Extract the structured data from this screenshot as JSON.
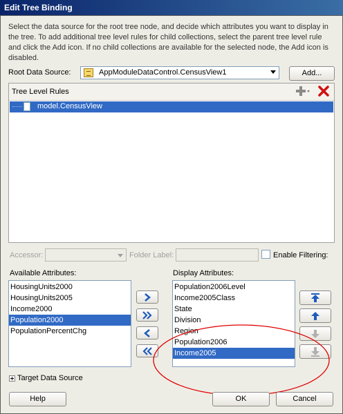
{
  "window": {
    "title": "Edit Tree Binding"
  },
  "description": "Select the data source for the root tree node, and decide which attributes you want to display in the tree. To add additional tree level rules for child collections, select the parent tree level rule and click the Add icon. If no child collections are available for the selected node, the Add icon is disabled.",
  "root_source": {
    "label": "Root Data Source:",
    "value": "AppModuleDataControl.CensusView1",
    "add_label": "Add..."
  },
  "tree_rules": {
    "header": "Tree Level Rules",
    "nodes": [
      "model.CensusView"
    ]
  },
  "accessor": {
    "label": "Accessor:",
    "value": ""
  },
  "folder_label": {
    "label": "Folder Label:",
    "value": ""
  },
  "enable_filtering": {
    "label": "Enable Filtering:",
    "checked": false
  },
  "available": {
    "label": "Available Attributes:",
    "items": [
      "HousingUnits2000",
      "HousingUnits2005",
      "Income2000",
      "Population2000",
      "PopulationPercentChg"
    ],
    "selected": 3
  },
  "display": {
    "label": "Display Attributes:",
    "items": [
      "Population2006Level",
      "Income2005Class",
      "State",
      "Division",
      "Region",
      "Population2006",
      "Income2005"
    ],
    "selected": 6
  },
  "target": {
    "label": "Target Data Source"
  },
  "buttons": {
    "help": "Help",
    "ok": "OK",
    "cancel": "Cancel"
  },
  "colors": {
    "selection": "#316ac5",
    "highlight_ellipse": "#e00000"
  }
}
